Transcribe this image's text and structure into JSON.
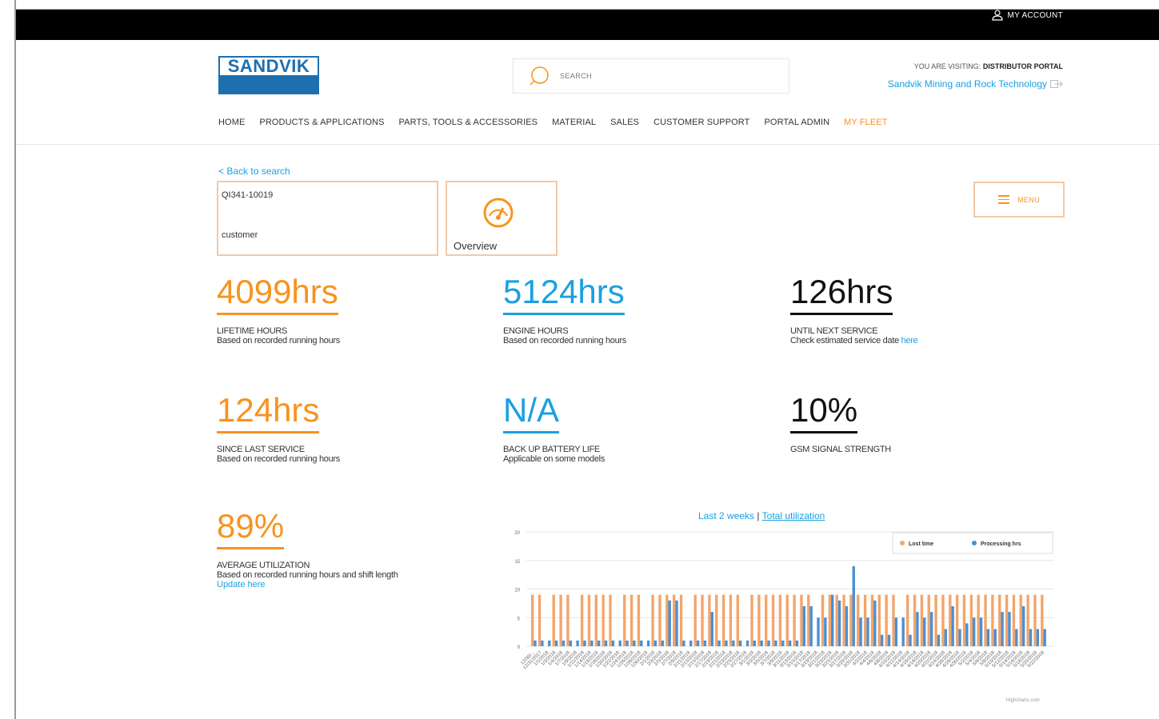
{
  "header": {
    "account_label": "MY ACCOUNT",
    "logo_text": "SANDVIK",
    "search_placeholder": "SEARCH",
    "visiting_prefix": "YOU ARE VISITING:",
    "visiting_portal": "DISTRIBUTOR PORTAL",
    "company_link": "Sandvik Mining and Rock Technology"
  },
  "nav": {
    "items": [
      "HOME",
      "PRODUCTS & APPLICATIONS",
      "PARTS, TOOLS & ACCESSORIES",
      "MATERIAL",
      "SALES",
      "CUSTOMER SUPPORT",
      "PORTAL ADMIN",
      "MY FLEET"
    ],
    "active_index": 7
  },
  "machine": {
    "back_link": "< Back to search",
    "id": "QI341-10019",
    "customer": "customer",
    "overview_label": "Overview",
    "menu_label": "MENU"
  },
  "stats": [
    {
      "value": "4099hrs",
      "label": "LIFETIME HOURS",
      "desc": "Based on recorded running hours",
      "color": "#f7931e"
    },
    {
      "value": "5124hrs",
      "label": "ENGINE HOURS",
      "desc": "Based on recorded running hours",
      "color": "#1aa0e0"
    },
    {
      "value": "126hrs",
      "label": "UNTIL NEXT SERVICE",
      "desc": "Check estimated service date",
      "link": "here",
      "color": "#111111"
    },
    {
      "value": "124hrs",
      "label": "SINCE LAST SERVICE",
      "desc": "Based on recorded running hours",
      "color": "#f7931e"
    },
    {
      "value": "N/A",
      "label": "BACK UP BATTERY LIFE",
      "desc": "Applicable on some models",
      "color": "#1aa0e0"
    },
    {
      "value": "10%",
      "label": "GSM SIGNAL STRENGTH",
      "desc": "",
      "color": "#111111"
    },
    {
      "value": "89%",
      "label": "AVERAGE UTILIZATION",
      "desc": "Based on recorded running hours and shift length",
      "link": "Update here",
      "color": "#f7931e"
    }
  ],
  "chart_tabs": {
    "left": "Last 2 weeks",
    "sep": "|",
    "right": "Total utilization"
  },
  "chart_credit": "Highcharts.com",
  "chart_data": {
    "type": "bar",
    "ylim": [
      0,
      20
    ],
    "yticks": [
      0,
      5,
      10,
      15,
      20
    ],
    "grid": true,
    "legend_position": "top-right",
    "categories": [
      "12/30/...",
      "12/31/2017",
      "1/1/2018",
      "1/3/2018",
      "1/4/2018",
      "1/7/2018",
      "1/9/2018",
      "1/11/2018",
      "1/14/2018",
      "1/16/2018",
      "1/18/2018",
      "1/20/2018",
      "1/22/2018",
      "1/24/2018",
      "1/26/2018",
      "1/28/2018",
      "1/30/2018",
      "2/1/2018",
      "2/3/2018",
      "2/5/2018",
      "2/7/2018",
      "2/9/2018",
      "2/11/2018",
      "2/13/2018",
      "2/15/2018",
      "2/17/2018",
      "2/19/2018",
      "2/21/2018",
      "2/23/2018",
      "2/25/2018",
      "2/27/2018",
      "3/1/2018",
      "3/3/2018",
      "3/5/2018",
      "3/7/2018",
      "3/9/2018",
      "3/11/2018",
      "3/13/2018",
      "3/15/2018",
      "3/17/2018",
      "3/19/2018",
      "3/21/2018",
      "3/23/2018",
      "3/25/2018",
      "3/27/2018",
      "3/29/2018",
      "3/31/2018",
      "4/2/2018",
      "4/4/2018",
      "4/6/2018",
      "4/8/2018",
      "4/10/2018",
      "4/12/2018",
      "4/14/2018",
      "4/16/2018",
      "4/18/2018",
      "4/20/2018",
      "4/22/2018",
      "4/24/2018",
      "4/26/2018",
      "4/28/2018",
      "4/30/2018",
      "5/2/2018",
      "5/4/2018",
      "5/6/2018",
      "5/8/2018",
      "5/10/2018",
      "5/12/2018",
      "5/14/2018",
      "5/16/2018",
      "5/18/2018",
      "5/20/2018",
      "5/22/2018"
    ],
    "series": [
      {
        "name": "Lost time",
        "color": "#f4a46a",
        "values": [
          9,
          9,
          0,
          9,
          9,
          9,
          0,
          9,
          9,
          9,
          9,
          9,
          0,
          9,
          9,
          9,
          0,
          9,
          9,
          9,
          9,
          9,
          0,
          9,
          9,
          9,
          9,
          9,
          9,
          9,
          0,
          9,
          9,
          9,
          9,
          9,
          9,
          9,
          9,
          9,
          0,
          9,
          9,
          9,
          9,
          9,
          9,
          9,
          9,
          9,
          9,
          9,
          0,
          9,
          9,
          9,
          9,
          9,
          9,
          9,
          9,
          9,
          9,
          9,
          9,
          9,
          9,
          9,
          9,
          9,
          9,
          9,
          9
        ]
      },
      {
        "name": "Processing hrs",
        "color": "#4a8fd4",
        "values": [
          1,
          1,
          1,
          1,
          1,
          1,
          1,
          1,
          1,
          1,
          1,
          1,
          1,
          1,
          1,
          1,
          1,
          1,
          1,
          8,
          8,
          1,
          1,
          1,
          1,
          6,
          1,
          1,
          1,
          1,
          1,
          1,
          1,
          1,
          1,
          1,
          1,
          1,
          7,
          7,
          5,
          5,
          9,
          8,
          7,
          14,
          5,
          5,
          8,
          2,
          2,
          5,
          5,
          2,
          6,
          5,
          6,
          2,
          3,
          7,
          3,
          4,
          5,
          5,
          3,
          3,
          6,
          6,
          3,
          7,
          3,
          3,
          3
        ]
      }
    ]
  },
  "colors": {
    "orange": "#f7931e",
    "blue": "#1aa0e0",
    "border": "#f2c9a8"
  }
}
